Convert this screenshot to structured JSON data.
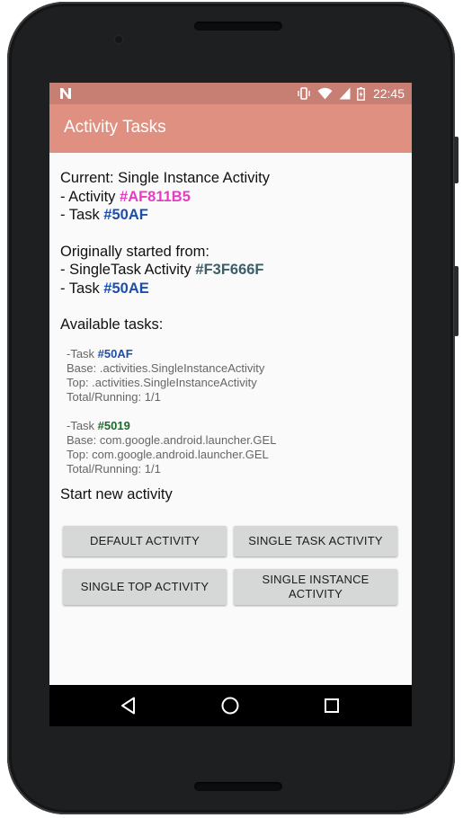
{
  "status_bar": {
    "time": "22:45"
  },
  "app_bar": {
    "title": "Activity Tasks"
  },
  "current": {
    "heading": "Current: Single Instance Activity",
    "activity_prefix": "- Activity ",
    "activity_id": "#AF811B5",
    "task_prefix": "- Task ",
    "task_id": "#50AF"
  },
  "origin": {
    "heading": "Originally started from:",
    "activity_prefix": "- SingleTask Activity ",
    "activity_id": "#F3F666F",
    "task_prefix": "- Task ",
    "task_id": "#50AE"
  },
  "available": {
    "heading": "Available tasks:",
    "tasks": [
      {
        "task_prefix": "-Task ",
        "task_id": "#50AF",
        "base": "Base: .activities.SingleInstanceActivity",
        "top": "Top: .activities.SingleInstanceActivity",
        "running": "Total/Running: 1/1"
      },
      {
        "task_prefix": "-Task ",
        "task_id": "#5019",
        "base": "Base: com.google.android.launcher.GEL",
        "top": "Top: com.google.android.launcher.GEL",
        "running": "Total/Running: 1/1"
      }
    ]
  },
  "start": {
    "heading": "Start new activity",
    "buttons": {
      "default": "DEFAULT ACTIVITY",
      "single_task": "SINGLE TASK ACTIVITY",
      "single_top": "SINGLE TOP ACTIVITY",
      "single_instance_line1": "SINGLE INSTANCE",
      "single_instance_line2": "ACTIVITY"
    }
  },
  "colors": {
    "app_bar": "#e09080",
    "status_bar": "#c77e73",
    "activity_id_current": "#e83cc3",
    "task_id_blue": "#1d4fa8",
    "activity_id_origin": "#3c5f6a",
    "task_id_green": "#1e6a2a"
  },
  "icons": {
    "status": [
      "notification-n-icon",
      "vibrate-icon",
      "wifi-icon",
      "signal-icon",
      "battery-icon"
    ],
    "nav": [
      "back-icon",
      "home-icon",
      "recents-icon"
    ]
  }
}
